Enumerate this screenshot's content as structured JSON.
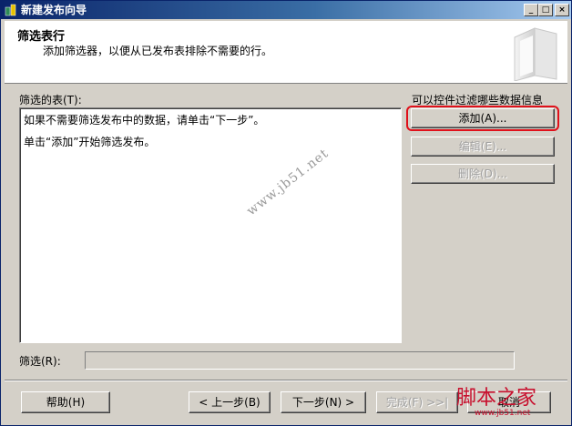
{
  "window": {
    "title": "新建发布向导",
    "controls": {
      "minimize": "_",
      "maximize": "□",
      "close": "×"
    }
  },
  "header": {
    "title": "筛选表行",
    "subtitle": "添加筛选器，以便从已发布表排除不需要的行。"
  },
  "tables_label": "筛选的表(T):",
  "filter_hint_label": "可以控件过滤哪些数据信息",
  "listbox_lines": [
    "如果不需要筛选发布中的数据，请单击“下一步”。",
    "单击“添加”开始筛选发布。"
  ],
  "side_buttons": {
    "add": "添加(A)...",
    "edit": "编辑(E)...",
    "delete": "删除(D)..."
  },
  "filter_label": "筛选(R):",
  "filter_value": "",
  "footer": {
    "help": "帮助(H)",
    "back": "< 上一步(B)",
    "next": "下一步(N) >",
    "finish": "完成(F) >>|",
    "cancel": "取消"
  },
  "watermark_center": "www.jb51.net",
  "watermark_corner": "脚本之家",
  "watermark_corner_url": "www.jb51.net",
  "colors": {
    "title_bar": "#0a246a",
    "dialog_face": "#d4d0c8",
    "highlight": "#e0101a"
  }
}
